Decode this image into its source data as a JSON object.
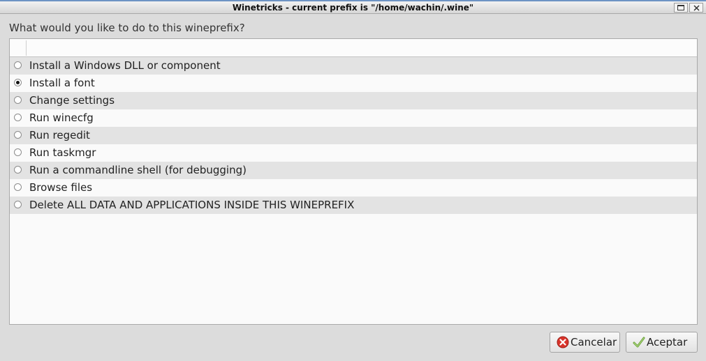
{
  "window": {
    "title": "Winetricks - current prefix is \"/home/wachin/.wine\""
  },
  "prompt": {
    "question": "What would you like to do to this wineprefix?"
  },
  "options": [
    {
      "label": "Install a Windows DLL or component",
      "selected": false
    },
    {
      "label": "Install a font",
      "selected": true
    },
    {
      "label": "Change settings",
      "selected": false
    },
    {
      "label": "Run winecfg",
      "selected": false
    },
    {
      "label": "Run regedit",
      "selected": false
    },
    {
      "label": "Run taskmgr",
      "selected": false
    },
    {
      "label": "Run a commandline shell (for debugging)",
      "selected": false
    },
    {
      "label": "Browse files",
      "selected": false
    },
    {
      "label": "Delete ALL DATA AND APPLICATIONS INSIDE THIS WINEPREFIX",
      "selected": false
    }
  ],
  "buttons": {
    "cancel_label": "Cancelar",
    "accept_label": "Aceptar",
    "cancel_icon": "cancel-icon",
    "accept_icon": "checkmark-icon"
  },
  "colors": {
    "cancel_icon": "#d9342b",
    "accept_icon": "#6aa33a",
    "titlebar_accent": "#6e94c4"
  }
}
